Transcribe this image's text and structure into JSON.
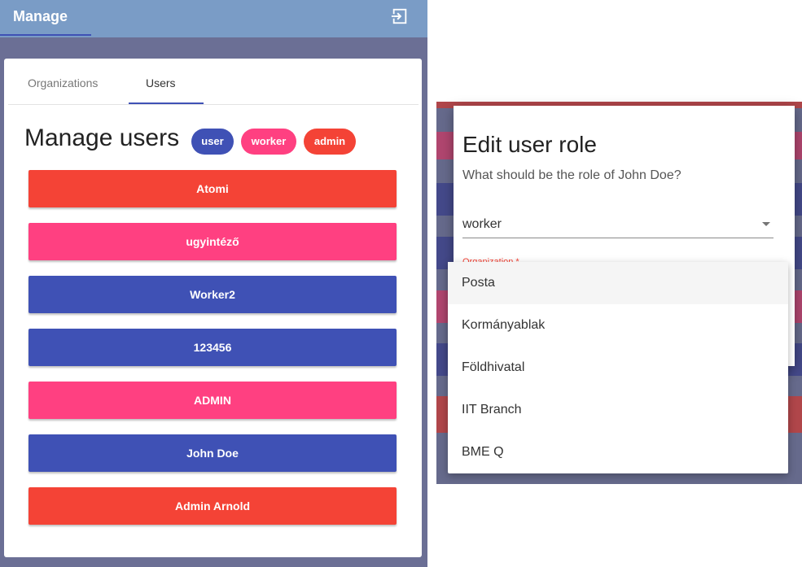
{
  "app": {
    "title": "Manage"
  },
  "tabs": [
    {
      "label": "Organizations",
      "active": false
    },
    {
      "label": "Users",
      "active": true
    }
  ],
  "heading": "Manage users",
  "legend": [
    {
      "label": "user",
      "color": "#3f51b5"
    },
    {
      "label": "worker",
      "color": "#ff4081"
    },
    {
      "label": "admin",
      "color": "#f44336"
    }
  ],
  "users": [
    {
      "name": "Atomi",
      "role": "admin",
      "color": "#f44336"
    },
    {
      "name": "ugyintéző",
      "role": "worker",
      "color": "#ff4081"
    },
    {
      "name": "Worker2",
      "role": "user",
      "color": "#3f51b5"
    },
    {
      "name": "123456",
      "role": "user",
      "color": "#3f51b5"
    },
    {
      "name": "ADMIN",
      "role": "worker",
      "color": "#ff4081"
    },
    {
      "name": "John Doe",
      "role": "user",
      "color": "#3f51b5"
    },
    {
      "name": "Admin Arnold",
      "role": "admin",
      "color": "#f44336"
    }
  ],
  "dialog": {
    "title": "Edit user role",
    "subtitle": "What should be the role of John Doe?",
    "role_value": "worker",
    "org_label": "Organization *"
  },
  "dropdown": {
    "options": [
      "Posta",
      "Kormányablak",
      "Földhivatal",
      "IIT Branch",
      "BME Q"
    ],
    "highlighted_index": 0
  },
  "icons": {
    "logout": "logout-icon",
    "select_caret": "arrow-drop-down-icon"
  }
}
